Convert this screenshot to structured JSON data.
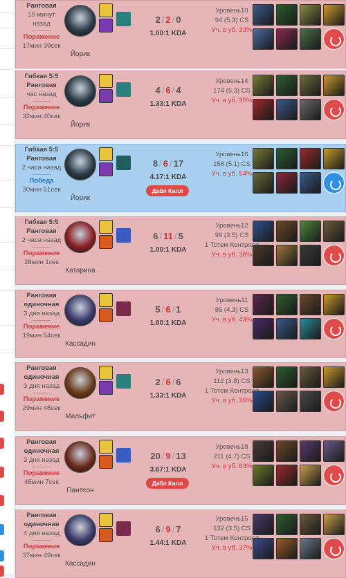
{
  "matches": [
    {
      "result_class": "loss",
      "queue": "Ранговая",
      "when": "19 минут назад",
      "result": "Поражение",
      "duration": "17мин 39сек",
      "champion": "Йорик",
      "kills": "2",
      "deaths": "2",
      "assists": "0",
      "kda": "1.00:1 KDA",
      "multikill": "",
      "level": "Уровень10",
      "cs": "94 (5.3) CS",
      "wards": "",
      "participation": "Уч. в уб. 33%",
      "champ_color": "#2a3a48",
      "spell1_color": "#e9c43a",
      "spell2_color": "#7a3ab0",
      "rune_color": "#2b7f7c",
      "items": [
        "#3d5a8a",
        "#2b5e2e",
        "#8a8a45",
        "#c99a2a",
        "#4a6aa0",
        "#8a2a52",
        "#4a6e4a"
      ],
      "trinket": "red"
    },
    {
      "result_class": "loss",
      "queue": "Гибкая 5:5 Ранговая",
      "when": "час назад",
      "result": "Поражение",
      "duration": "32мин 40сек",
      "champion": "Йорик",
      "kills": "4",
      "deaths": "6",
      "assists": "4",
      "kda": "1.33:1 KDA",
      "multikill": "",
      "level": "Уровень14",
      "cs": "174 (5.3) CS",
      "wards": "",
      "participation": "Уч. в уб. 35%",
      "champ_color": "#2a3a48",
      "spell1_color": "#e9c43a",
      "spell2_color": "#7a3ab0",
      "rune_color": "#2b7f7c",
      "items": [
        "#7a7a35",
        "#2b5e2e",
        "#6a6a3a",
        "#c99a2a",
        "#9a2a2a",
        "#3a5a8a",
        "#6a6a6a"
      ],
      "trinket": "red"
    },
    {
      "result_class": "win",
      "queue": "Гибкая 5:5 Ранговая",
      "when": "2 часа назад",
      "result": "Победа",
      "duration": "30мин 51сек",
      "champion": "Йорик",
      "kills": "8",
      "deaths": "6",
      "assists": "17",
      "kda": "4.17:1 KDA",
      "multikill": "Дабл Килл",
      "level": "Уровень16",
      "cs": "158 (5.1) CS",
      "wards": "",
      "participation": "Уч. в уб. 54%",
      "champ_color": "#2a3a48",
      "spell1_color": "#e9c43a",
      "spell2_color": "#7a3ab0",
      "rune_color": "#1f5e5c",
      "items": [
        "#7a7a35",
        "#2b5e2e",
        "#9a2a2a",
        "#c99a2a",
        "#6a6a3a",
        "#8a2a3a",
        "#3a5a8a"
      ],
      "trinket": "blue"
    },
    {
      "result_class": "loss",
      "queue": "Гибкая 5:5 Ранговая",
      "when": "2 часа назад",
      "result": "Поражение",
      "duration": "28мин 1сек",
      "champion": "Катарина",
      "kills": "6",
      "deaths": "11",
      "assists": "5",
      "kda": "1.00:1 KDA",
      "multikill": "",
      "level": "Уровень12",
      "cs": "99 (3.5) CS",
      "wards": "1 Тотем Контроля",
      "participation": "Уч. в уб. 38%",
      "champ_color": "#8a1f24",
      "spell1_color": "#e9c43a",
      "spell2_color": "#d95a1a",
      "rune_color": "#3a5cc0",
      "items": [
        "#2f4e8a",
        "#6a4a2a",
        "#4a8a3a",
        "#6a5a3a",
        "#4a3a2a",
        "#9a7a3a",
        "#3a3a3a"
      ],
      "trinket": "red"
    },
    {
      "result_class": "loss",
      "queue": "Ранговая одиночная",
      "when": "3 дня назад",
      "result": "Поражение",
      "duration": "19мин 54сек",
      "champion": "Кассадин",
      "kills": "5",
      "deaths": "6",
      "assists": "1",
      "kda": "1.00:1 KDA",
      "multikill": "",
      "level": "Уровень11",
      "cs": "85 (4.3) CS",
      "wards": "",
      "participation": "Уч. в уб. 43%",
      "champ_color": "#3a3a6a",
      "spell1_color": "#e9c43a",
      "spell2_color": "#d95a1a",
      "rune_color": "#7a2a4a",
      "items": [
        "#5a2a4a",
        "#2b5e2e",
        "#6a4a2a",
        "#c99a2a",
        "#4a2a6a",
        "#3a5a8a",
        "#2a8a9a"
      ],
      "trinket": "red"
    },
    {
      "result_class": "loss",
      "queue": "Ранговая одиночная",
      "when": "3 дня назад",
      "result": "Поражение",
      "duration": "29мин 48сек",
      "champion": "Мальфит",
      "kills": "2",
      "deaths": "6",
      "assists": "6",
      "kda": "1.33:1 KDA",
      "multikill": "",
      "level": "Уровень13",
      "cs": "112 (3.8) CS",
      "wards": "1 Тотем Контроля",
      "participation": "Уч. в уб. 35%",
      "champ_color": "#6a3a1a",
      "spell1_color": "#e9c43a",
      "spell2_color": "#7a3ab0",
      "rune_color": "#2b7f7c",
      "items": [
        "#8a5a2a",
        "#2b5e2e",
        "#6a5a3a",
        "#c99a2a",
        "#2a4a8a",
        "#6a5a4a",
        "#4a4a4a"
      ],
      "trinket": "red"
    },
    {
      "result_class": "loss",
      "queue": "Ранговая одиночная",
      "when": "3 дня назад",
      "result": "Поражение",
      "duration": "45мин 7сек",
      "champion": "Пантеон",
      "kills": "20",
      "deaths": "9",
      "assists": "13",
      "kda": "3.67:1 KDA",
      "multikill": "Дабл Килл",
      "level": "Уровень18",
      "cs": "211 (4.7) CS",
      "wards": "",
      "participation": "Уч. в уб. 63%",
      "champ_color": "#6a2a1a",
      "spell1_color": "#e9c43a",
      "spell2_color": "#d95a1a",
      "rune_color": "#3a5cc0",
      "items": [
        "#4a3a3a",
        "#6a4a2a",
        "#5a3a6a",
        "#6a5a8a",
        "#6a7a2a",
        "#9a2a2a",
        "#c9a04a"
      ],
      "trinket": "red"
    },
    {
      "result_class": "loss",
      "queue": "Ранговая одиночная",
      "when": "4 дня назад",
      "result": "Поражение",
      "duration": "37мин 49сек",
      "champion": "Кассадин",
      "kills": "6",
      "deaths": "9",
      "assists": "7",
      "kda": "1.44:1 KDA",
      "multikill": "",
      "level": "Уровень15",
      "cs": "132 (3.5) CS",
      "wards": "1 Тотем Контроля",
      "participation": "Уч. в уб. 37%",
      "champ_color": "#3a3a6a",
      "spell1_color": "#e9c43a",
      "spell2_color": "#d95a1a",
      "rune_color": "#7a2a4a",
      "items": [
        "#4a3a6a",
        "#2b5e2e",
        "#6a5a3a",
        "#c9a04a",
        "#3a4a8a",
        "#9a5a2a",
        "#6a7a8a"
      ],
      "trinket": "red"
    }
  ],
  "left_pills": [
    "#e14848",
    "#e14848",
    "#e14848",
    "#e14848",
    "#e14848",
    "#2f8fe0",
    "#2f8fe0",
    "#e14848"
  ]
}
